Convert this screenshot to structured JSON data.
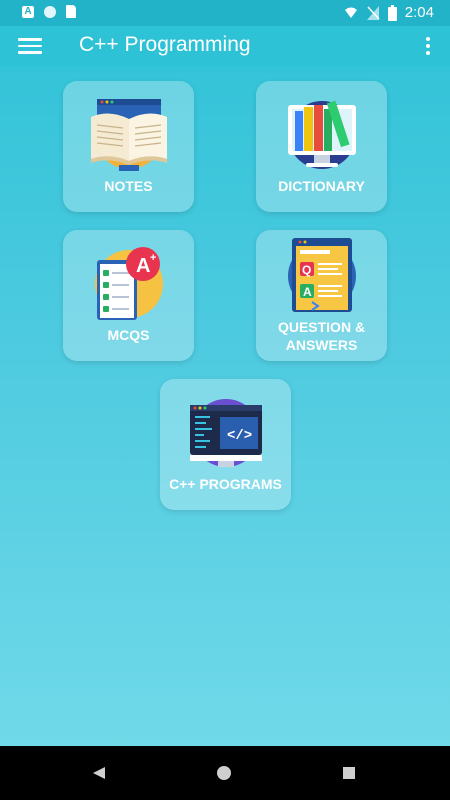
{
  "status_bar": {
    "time": "2:04",
    "notif_a": "A"
  },
  "app_bar": {
    "title": "C++ Programming"
  },
  "tiles": [
    {
      "label": "NOTES",
      "icon": "open-book-icon"
    },
    {
      "label": "DICTIONARY",
      "icon": "books-monitor-icon"
    },
    {
      "label": "MCQS",
      "icon": "grade-a-plus-icon"
    },
    {
      "label": "QUESTION & ANSWERS",
      "icon": "qa-document-icon"
    },
    {
      "label": "C++ PROGRAMS",
      "icon": "code-monitor-icon"
    }
  ],
  "colors": {
    "accent": "#2ec2d7",
    "status_bar": "#23b3c8",
    "nav_bar": "#000000"
  }
}
